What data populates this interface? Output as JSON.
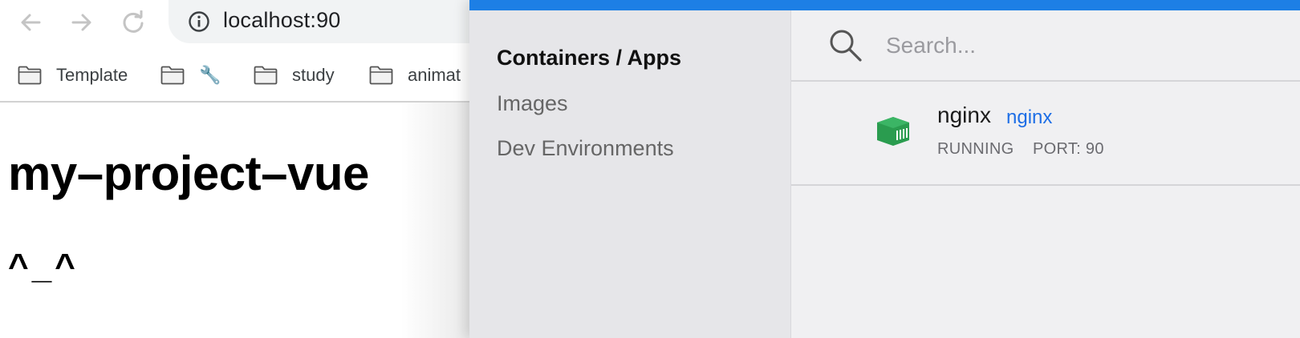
{
  "browser": {
    "address": "localhost:90",
    "bookmarks": [
      {
        "label": "Template",
        "icon": "folder-icon"
      },
      {
        "label": "🔧",
        "icon": "folder-icon"
      },
      {
        "label": "study",
        "icon": "folder-icon"
      },
      {
        "label": "animat",
        "icon": "folder-icon"
      }
    ],
    "page": {
      "heading": "my–project–vue",
      "subheading": "^_^"
    }
  },
  "docker": {
    "accent_color": "#1d7fe5",
    "sidebar": {
      "items": [
        {
          "label": "Containers / Apps",
          "active": true
        },
        {
          "label": "Images",
          "active": false
        },
        {
          "label": "Dev Environments",
          "active": false
        }
      ]
    },
    "search": {
      "placeholder": "Search..."
    },
    "containers": [
      {
        "name": "nginx",
        "image": "nginx",
        "status": "RUNNING",
        "port": "PORT: 90",
        "icon": "container-icon",
        "icon_color": "#2a9c4f"
      }
    ]
  }
}
